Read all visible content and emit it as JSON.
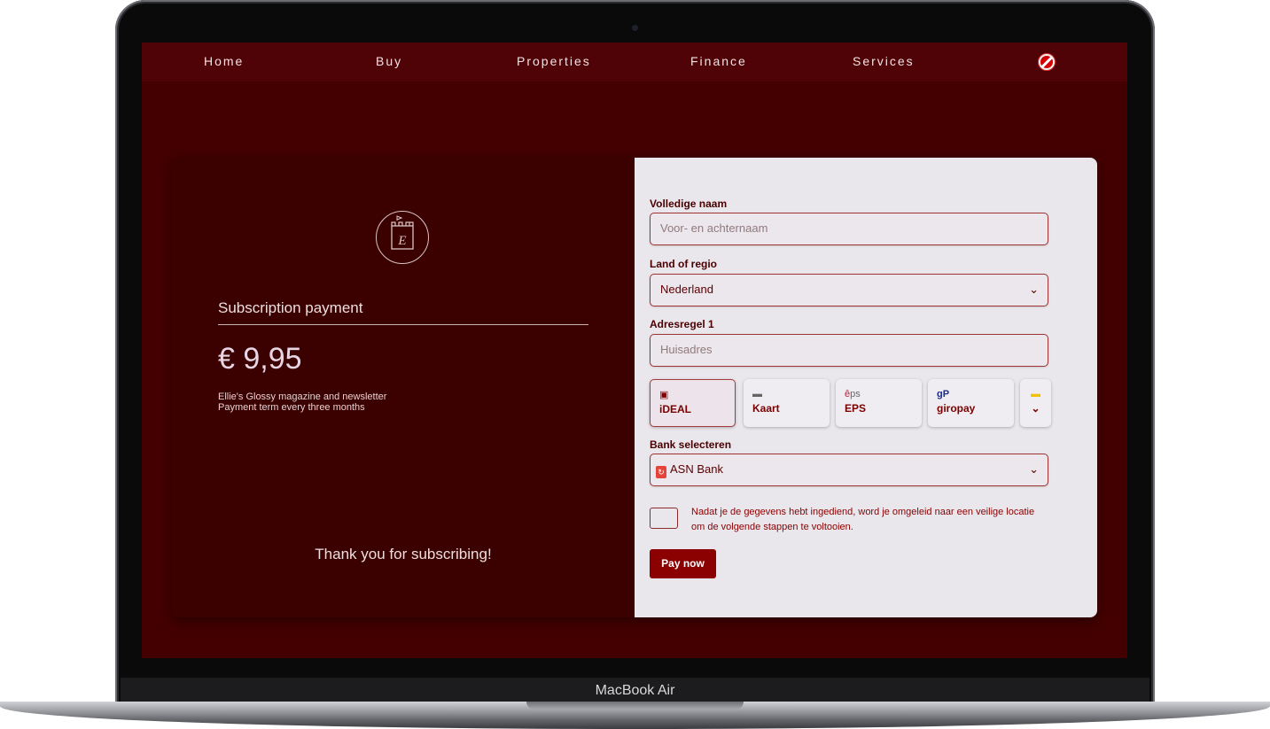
{
  "device": {
    "label": "MacBook Air"
  },
  "nav": {
    "items": [
      "Home",
      "Buy",
      "Properties",
      "Finance",
      "Services"
    ],
    "block_icon": "block-icon"
  },
  "summary": {
    "title": "Subscription payment",
    "price": "€ 9,95",
    "desc_line1": "Ellie's Glossy magazine and newsletter",
    "desc_line2": "Payment term every three months",
    "thanks": "Thank you for subscribing!"
  },
  "form": {
    "name_label": "Volledige naam",
    "name_placeholder": "Voor- en achternaam",
    "country_label": "Land of regio",
    "country_value": "Nederland",
    "address_label": "Adresregel 1",
    "address_placeholder": "Huisadres",
    "methods": [
      {
        "name": "iDEAL",
        "icon": "ideal-icon",
        "active": true
      },
      {
        "name": "Kaart",
        "icon": "card-icon",
        "active": false
      },
      {
        "name": "EPS",
        "icon": "eps-icon",
        "active": false
      },
      {
        "name": "giropay",
        "icon": "giropay-icon",
        "active": false
      }
    ],
    "bank_label": "Bank selecteren",
    "bank_value": "ASN Bank",
    "info_text": "Nadat je de gegevens hebt ingediend, word je omgeleid naar een veilige locatie om de volgende stappen te voltooien.",
    "pay_label": "Pay now"
  },
  "colors": {
    "background": "#440000",
    "accent": "#8b0000",
    "panel": "#e9e6ec"
  }
}
